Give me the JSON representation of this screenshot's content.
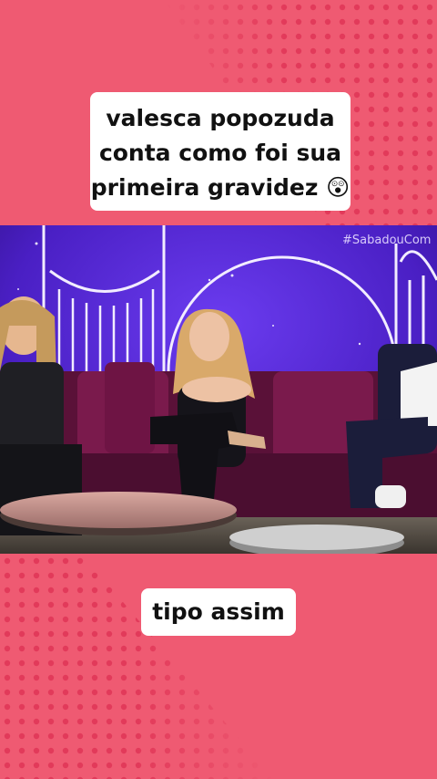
{
  "video_title_caption": "valesca popozuda conta como foi sua primeira gravidez",
  "caption_lines": [
    "valesca popozuda",
    "conta como foi sua",
    "primeira gravidez"
  ],
  "caption_emoji": "😲",
  "subtitle": "tipo assim",
  "watermark_hashtag": "#SabadouCom",
  "colors": {
    "background": "#ef5a72",
    "dots": "#e23a5a",
    "stage_purple": "#5a2bd6",
    "sofa": "#5a1138"
  }
}
